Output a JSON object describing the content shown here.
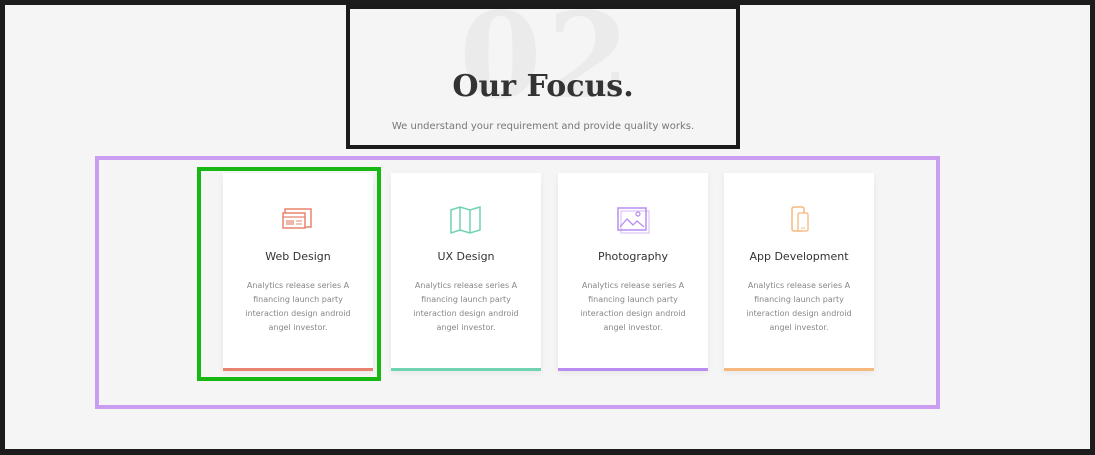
{
  "section": {
    "number": "02",
    "title": "Our Focus.",
    "subtitle": "We understand your requirement and provide quality works."
  },
  "cards": [
    {
      "title": "Web Design",
      "text": "Analytics release series A financing launch party interaction design android angel investor.",
      "icon": "web-design-icon",
      "color": "#e8836f"
    },
    {
      "title": "UX Design",
      "text": "Analytics release series A financing launch party interaction design android angel investor.",
      "icon": "map-icon",
      "color": "#6fd3b2"
    },
    {
      "title": "Photography",
      "text": "Analytics release series A financing launch party interaction design android angel investor.",
      "icon": "image-icon",
      "color": "#b98df0"
    },
    {
      "title": "App Development",
      "text": "Analytics release series A financing launch party interaction design android angel investor.",
      "icon": "mobile-icon",
      "color": "#f6b87c"
    }
  ]
}
